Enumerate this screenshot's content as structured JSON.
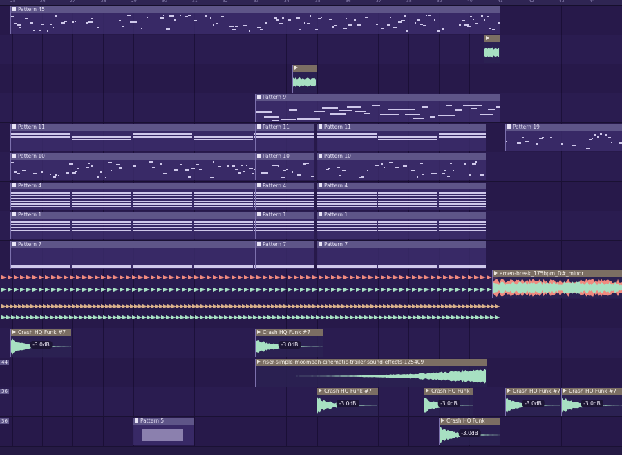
{
  "ruler": {
    "bars": [
      "25",
      "26",
      "27",
      "28",
      "29",
      "30",
      "31",
      "32",
      "33",
      "34",
      "35",
      "36",
      "37",
      "38",
      "39",
      "40",
      "41",
      "42",
      "43",
      "44"
    ]
  },
  "colors": {
    "background": "#251a44",
    "pattern_header": "#5e5588",
    "audio_header": "#7b6e63",
    "note": "#cfc8ea",
    "wave_green": "#a7e0c2",
    "wave_red": "#f08a7f"
  },
  "tracks": [
    {
      "clips": [
        {
          "label": "Pattern 45",
          "type": "pattern",
          "style": "dense"
        }
      ]
    },
    {
      "clips": [
        {
          "label": "",
          "type": "audio",
          "style": "stub"
        }
      ]
    },
    {
      "clips": [
        {
          "label": "",
          "type": "audio",
          "style": "stub"
        }
      ]
    },
    {
      "clips": [
        {
          "label": "Pattern 9",
          "type": "pattern",
          "style": "melody"
        }
      ]
    },
    {
      "clips": [
        {
          "label": "Pattern 11",
          "type": "pattern",
          "style": "long"
        },
        {
          "label": "Pattern 11",
          "type": "pattern",
          "style": "long"
        },
        {
          "label": "Pattern 11",
          "type": "pattern",
          "style": "long"
        },
        {
          "label": "Pattern 19",
          "type": "pattern",
          "style": "dense"
        }
      ]
    },
    {
      "clips": [
        {
          "label": "Pattern 10",
          "type": "pattern",
          "style": "dense"
        },
        {
          "label": "Pattern 10",
          "type": "pattern",
          "style": "dense"
        },
        {
          "label": "Pattern 10",
          "type": "pattern",
          "style": "dense"
        }
      ]
    },
    {
      "clips": [
        {
          "label": "Pattern 4",
          "type": "pattern",
          "style": "stack"
        },
        {
          "label": "Pattern 4",
          "type": "pattern",
          "style": "stack"
        },
        {
          "label": "Pattern 4",
          "type": "pattern",
          "style": "stack"
        }
      ]
    },
    {
      "clips": [
        {
          "label": "Pattern 1",
          "type": "pattern",
          "style": "chord"
        },
        {
          "label": "Pattern 1",
          "type": "pattern",
          "style": "chord"
        },
        {
          "label": "Pattern 1",
          "type": "pattern",
          "style": "chord"
        }
      ]
    },
    {
      "clips": [
        {
          "label": "Pattern 7",
          "type": "pattern",
          "style": "bass"
        },
        {
          "label": "Pattern 7",
          "type": "pattern",
          "style": "bass"
        },
        {
          "label": "Pattern 7",
          "type": "pattern",
          "style": "bass"
        }
      ]
    },
    {
      "clips": [
        {
          "label": "amen-break_175bpm_D#_minor",
          "type": "audio",
          "style": "loud"
        }
      ]
    },
    {
      "clips": []
    },
    {
      "clips": [
        {
          "label": "Crash HQ Funk #7",
          "type": "audio",
          "style": "crash",
          "gain": "-3.0dB"
        },
        {
          "label": "Crash HQ Funk #7",
          "type": "audio",
          "style": "crash",
          "gain": "-3.0dB"
        }
      ]
    },
    {
      "clips": [
        {
          "label": "riser-simple-moombah-cinematic-trailer-sound-effects-125409",
          "type": "audio",
          "style": "riser"
        }
      ]
    },
    {
      "clips": [
        {
          "label": "Crash HQ Funk #7",
          "type": "audio",
          "style": "crash",
          "gain": "-3.0dB"
        },
        {
          "label": "Crash HQ Funk",
          "type": "audio",
          "style": "crash",
          "gain": "-3.0dB"
        },
        {
          "label": "Crash HQ Funk #7",
          "type": "audio",
          "style": "crash",
          "gain": "-3.0dB"
        },
        {
          "label": "Crash HQ Funk #7",
          "type": "audio",
          "style": "crash",
          "gain": "-3.0dB"
        }
      ]
    },
    {
      "clips": [
        {
          "label": "Pattern 5",
          "type": "pattern",
          "style": "wide"
        },
        {
          "label": "Crash HQ Funk",
          "type": "audio",
          "style": "crash",
          "gain": "-3.0dB"
        }
      ]
    }
  ],
  "edge_labels": [
    "44",
    "36",
    "36"
  ]
}
